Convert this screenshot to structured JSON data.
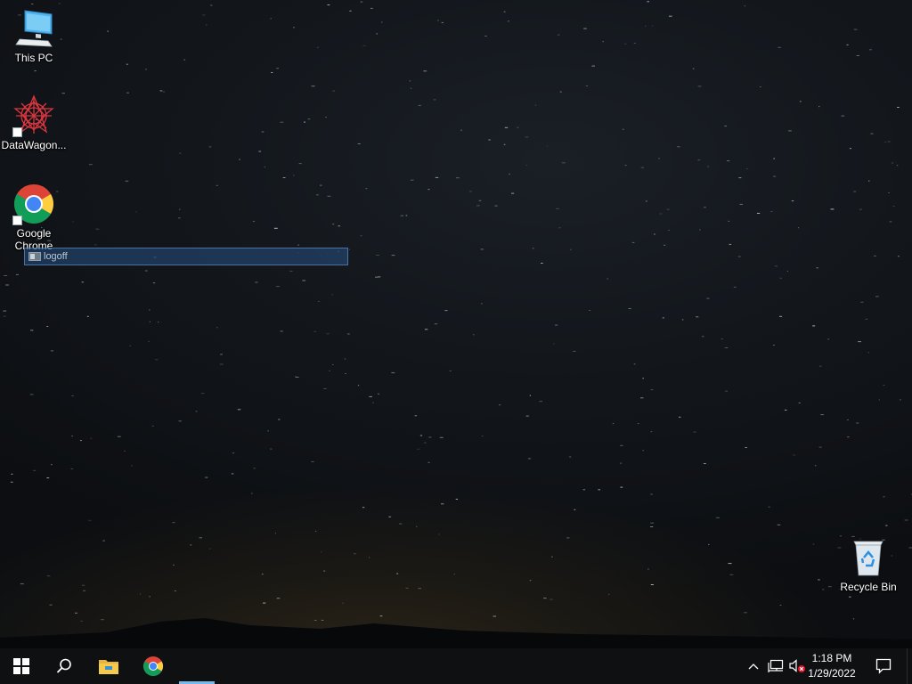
{
  "desktop": {
    "icons": [
      {
        "label": "This PC",
        "icon": "monitor-icon"
      },
      {
        "label": "DataWagon...",
        "icon": "datawagon-icon"
      },
      {
        "label": "Google Chrome",
        "icon": "chrome-icon"
      },
      {
        "label": "Recycle Bin",
        "icon": "recycle-bin-icon"
      }
    ],
    "rename_bar": {
      "text": "logoff",
      "icon": "shortcut-file-icon"
    }
  },
  "taskbar": {
    "start": "windows-logo-icon",
    "search": "search-icon",
    "pinned": [
      "file-explorer-icon",
      "chrome-icon"
    ],
    "tray": [
      "chevron-up-icon",
      "network-icon",
      "volume-muted-icon"
    ],
    "clock": {
      "time": "1:18 PM",
      "date": "1/29/2022"
    },
    "notifications": "notification-icon"
  },
  "colors": {
    "taskbar_bg": "#0f1012",
    "accent": "#76b9ed",
    "rename_bg": "#265082"
  }
}
